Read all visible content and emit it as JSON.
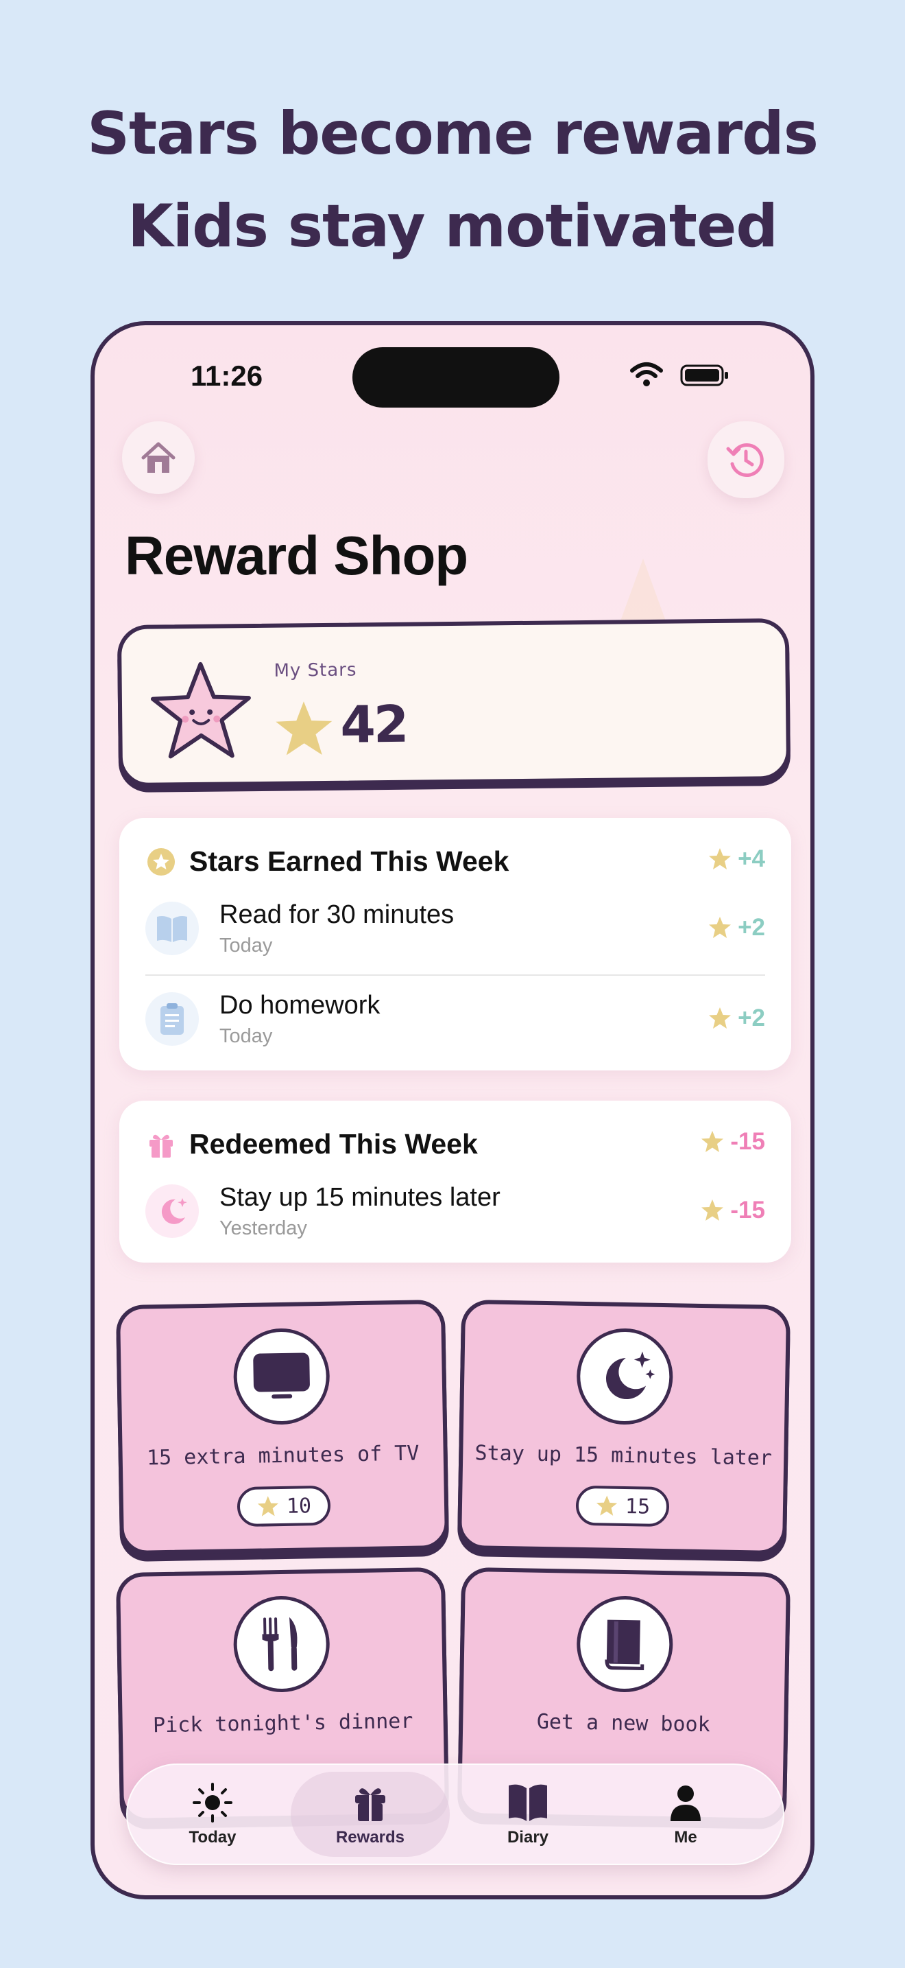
{
  "marketing": {
    "line1": "Stars become rewards",
    "line2": "Kids stay motivated"
  },
  "status_bar": {
    "time": "11:26"
  },
  "header": {
    "title": "Reward Shop",
    "home_icon": "home-icon",
    "history_icon": "history-icon"
  },
  "my_stars": {
    "label": "My Stars",
    "count": "42"
  },
  "earned": {
    "title": "Stars Earned This Week",
    "total": "+4",
    "items": [
      {
        "title": "Read for 30 minutes",
        "subtitle": "Today",
        "delta": "+2",
        "icon": "book-icon"
      },
      {
        "title": "Do homework",
        "subtitle": "Today",
        "delta": "+2",
        "icon": "clipboard-icon"
      }
    ]
  },
  "redeemed": {
    "title": "Redeemed This Week",
    "total": "-15",
    "items": [
      {
        "title": "Stay up 15 minutes later",
        "subtitle": "Yesterday",
        "delta": "-15",
        "icon": "moon-icon"
      }
    ]
  },
  "rewards": [
    {
      "label": "15 extra minutes of TV",
      "price": "10",
      "icon": "tv-icon"
    },
    {
      "label": "Stay up 15 minutes later",
      "price": "15",
      "icon": "moon-stars-icon"
    },
    {
      "label": "Pick tonight's dinner",
      "price": "",
      "icon": "fork-knife-icon"
    },
    {
      "label": "Get a new book",
      "price": "",
      "icon": "book-icon"
    }
  ],
  "tabs": [
    {
      "label": "Today",
      "icon": "sun-icon"
    },
    {
      "label": "Rewards",
      "icon": "gift-icon",
      "selected": true
    },
    {
      "label": "Diary",
      "icon": "open-book-icon"
    },
    {
      "label": "Me",
      "icon": "person-icon"
    }
  ],
  "colors": {
    "background": "#d9e8f8",
    "ink": "#3d2a4f",
    "card_pink": "#f4c3dc",
    "star_gold": "#e8cf85",
    "earned_green": "#8ccdc2",
    "redeemed_pink": "#ef7fb6"
  }
}
